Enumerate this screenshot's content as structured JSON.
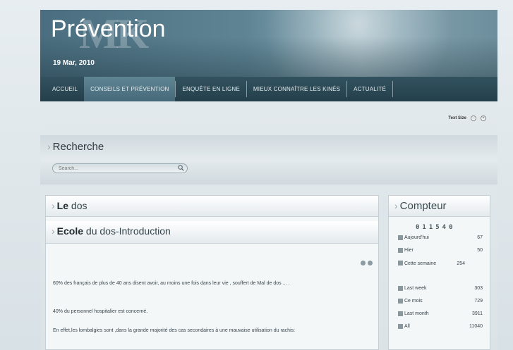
{
  "header": {
    "logo_text": "Prévention",
    "logo_mark": "MK",
    "date": "19 Mar, 2010"
  },
  "nav": {
    "items": [
      {
        "label": "ACCUEIL",
        "active": false
      },
      {
        "label": "CONSEILS ET PRÉVENTION",
        "active": true
      },
      {
        "label": "ENQUÊTE EN LIGNE",
        "active": false
      },
      {
        "label": "MIEUX CONNAÎTRE LES KINÉS",
        "active": false
      },
      {
        "label": "ACTUALITÉ",
        "active": false
      }
    ]
  },
  "textsize": {
    "label": "Text Size",
    "decrease": "–",
    "increase": "+"
  },
  "search": {
    "heading": "Recherche",
    "placeholder": "Search..."
  },
  "main": {
    "title_bold": "Le",
    "title_rest": " dos",
    "article_title_bold": "Ecole",
    "article_title_rest": " du dos-Introduction",
    "paragraphs": [
      "60% des français de plus de 40 ans disent avoir, au moins une fois dans leur vie , souffert de Mal de dos ... .",
      "40% du personnel hospitalier est concerné.",
      "En effet,les lombalgies sont ,dans la grande majorité des cas secondaires à une mauvaise utilisation du rachis:"
    ]
  },
  "counter": {
    "title": "Compteur",
    "digits": "011540",
    "rows": [
      {
        "label": "Aujourd'hui",
        "value": "67"
      },
      {
        "label": "Hier",
        "value": "50"
      },
      {
        "label": "Cette semaine",
        "value": "254"
      },
      {
        "label": "Last week",
        "value": "303"
      },
      {
        "label": "Ce mois",
        "value": "729"
      },
      {
        "label": "Last month",
        "value": "3911"
      },
      {
        "label": "All",
        "value": "11040"
      }
    ]
  }
}
